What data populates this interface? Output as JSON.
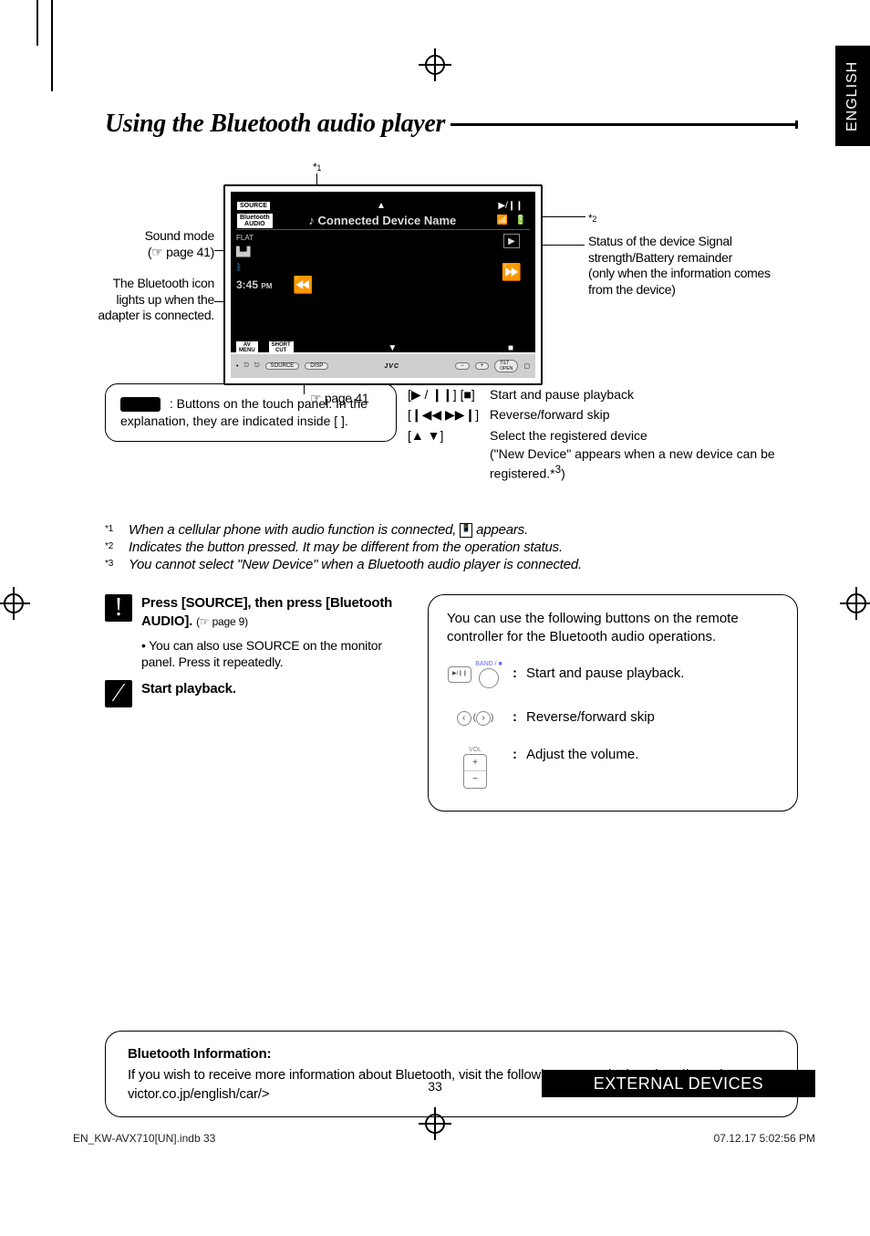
{
  "heading": "Using the Bluetooth audio player",
  "language_tab": "ENGLISH",
  "diagram": {
    "star1": "*1",
    "star2": "*2",
    "soundmode_label": "Sound mode",
    "soundmode_ref": "(☞ page 41)",
    "bticon_label": "The Bluetooth icon lights up when the adapter is connected.",
    "status_label": "Status of the device Signal strength/Battery remainder",
    "status_label2": "(only when the information comes from the device)",
    "page41_ref": "page 41",
    "screen": {
      "source_chip": "SOURCE",
      "bt_audio_chip1": "Bluetooth",
      "bt_audio_chip2": "AUDIO",
      "title": "Connected Device Name",
      "flat": "FLAT",
      "time": "3:45",
      "pm": "PM",
      "avmenu": "AV\nMENU",
      "short": "SHORT\nCUT",
      "jvc": "JVC",
      "source_btn": "SOURCE",
      "disp_btn": "DISP"
    }
  },
  "touchpanel_note": ": Buttons on the touch panel. In the explanation, they are indicated inside [      ].",
  "button_legend": {
    "b1_key": "[▶ / ❙❙] [■]",
    "b1": "Start and pause playback",
    "b2_key": "[❙◀◀ ▶▶❙]",
    "b2": "Reverse/forward skip",
    "b3_key": "[▲ ▼]",
    "b3a": "Select the registered device",
    "b3b": "(\"New Device\" appears when a new device can be registered.*",
    "b3sup": "3",
    "b3c": ")"
  },
  "footnotes": {
    "f1_sup": "*1",
    "f1": "When a cellular phone with audio function is connected, ",
    "f1b": " appears.",
    "f2_sup": "*2",
    "f2": "Indicates the button pressed. It may be different from the operation status.",
    "f3_sup": "*3",
    "f3": "You cannot select \"New Device\" when a Bluetooth audio player is connected."
  },
  "steps": {
    "s1_num": "!",
    "s1a": "Press [SOURCE], then press [Bluetooth AUDIO].",
    "s1b": "(☞ page 9)",
    "s1c": "You can also use SOURCE on the monitor panel. Press it repeatedly.",
    "s2_num": "⁄",
    "s2": "Start playback."
  },
  "remote": {
    "intro": "You can use the following buttons on the remote controller for the Bluetooth audio operations.",
    "band_label": "BAND / ■",
    "r1": "Start and pause playback.",
    "r2": "Reverse/forward skip",
    "vol_label": "VOL",
    "r3": "Adjust the volume."
  },
  "bt_info": {
    "title": "Bluetooth Information:",
    "body": "If you wish to receive more information about Bluetooth, visit the following JVC web site: <http://www.jvc-victor.co.jp/english/car/>"
  },
  "page_number": "33",
  "section_tab": "EXTERNAL DEVICES",
  "footer": {
    "left": "EN_KW-AVX710[UN].indb   33",
    "right": "07.12.17   5:02:56 PM"
  }
}
